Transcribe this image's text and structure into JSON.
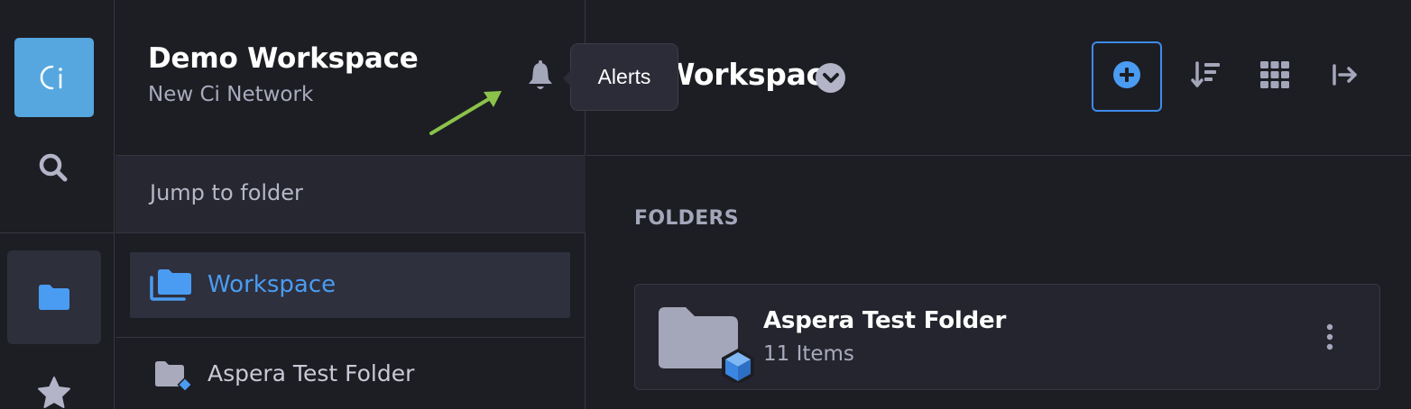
{
  "colors": {
    "background": "#1d1e24",
    "accent": "#4a9cf2",
    "logo": "#56a7df",
    "annotation_arrow": "#8bc34a",
    "icon_muted": "#a4a6ba"
  },
  "rail": {
    "logo_icon": "ci-logo-icon",
    "search_icon": "search-icon",
    "folders_icon": "folder-icon",
    "favorites_icon": "star-icon"
  },
  "sidebar": {
    "workspace_name": "Demo Workspace",
    "network_name": "New Ci Network",
    "bell_icon": "bell-icon",
    "jump_to_folder": "Jump to folder",
    "items": [
      {
        "label": "Workspace",
        "icon": "folders-stack-icon",
        "active": true
      },
      {
        "label": "Aspera Test Folder",
        "icon": "aspera-folder-icon",
        "active": false
      }
    ]
  },
  "tooltip": {
    "text": "Alerts"
  },
  "main": {
    "title": "Workspace",
    "title_caret_icon": "chevron-down-icon",
    "toolbar": {
      "add_icon": "plus-circle-icon",
      "sort_icon": "sort-icon",
      "grid_icon": "grid-icon",
      "collapse_icon": "arrow-right-bar-icon"
    },
    "section_label": "FOLDERS",
    "folders": [
      {
        "name": "Aspera Test Folder",
        "count": "11 Items",
        "more_icon": "more-vertical-icon"
      }
    ]
  }
}
